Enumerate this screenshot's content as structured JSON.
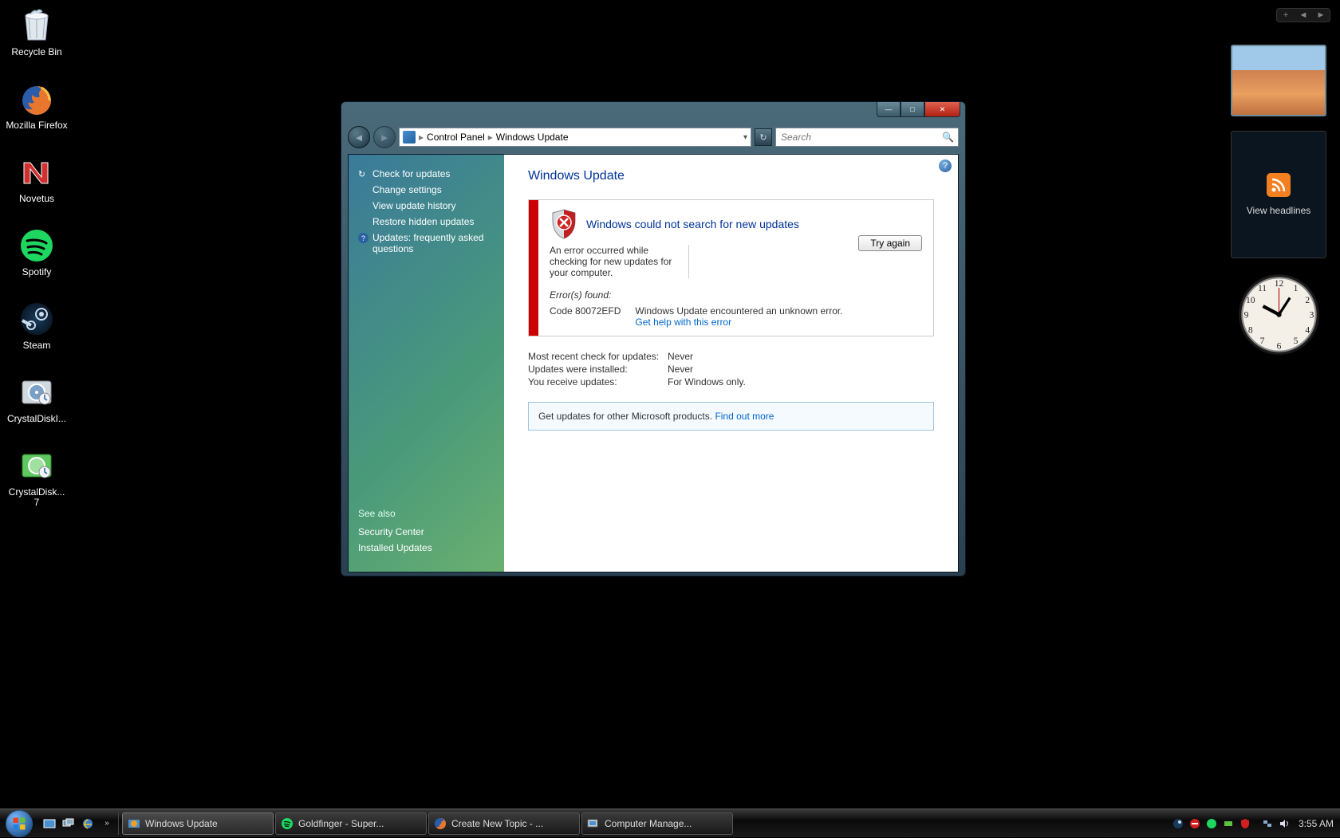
{
  "desktop": {
    "icons": [
      {
        "id": "recycle-bin",
        "label": "Recycle Bin"
      },
      {
        "id": "mozilla-firefox",
        "label": "Mozilla Firefox"
      },
      {
        "id": "novetus",
        "label": "Novetus"
      },
      {
        "id": "spotify",
        "label": "Spotify"
      },
      {
        "id": "steam",
        "label": "Steam"
      },
      {
        "id": "crystaldiskinfo",
        "label": "CrystalDiskI..."
      },
      {
        "id": "crystaldiskinfo7",
        "label": "CrystalDisk... 7"
      }
    ]
  },
  "window": {
    "breadcrumb": {
      "root": "Control Panel",
      "leaf": "Windows Update"
    },
    "search_placeholder": "Search",
    "sidebar": {
      "links": [
        {
          "id": "check-for-updates",
          "label": "Check for updates",
          "icon": "↻"
        },
        {
          "id": "change-settings",
          "label": "Change settings",
          "icon": ""
        },
        {
          "id": "view-update-history",
          "label": "View update history",
          "icon": ""
        },
        {
          "id": "restore-hidden-updates",
          "label": "Restore hidden updates",
          "icon": ""
        },
        {
          "id": "faq",
          "label": "Updates: frequently asked questions",
          "icon": "?"
        }
      ],
      "see_also_heading": "See also",
      "see_also": [
        {
          "id": "security-center",
          "label": "Security Center"
        },
        {
          "id": "installed-updates",
          "label": "Installed Updates"
        }
      ]
    },
    "main": {
      "title": "Windows Update",
      "error_heading": "Windows could not search for new updates",
      "error_body": "An error occurred while checking for new updates for your computer.",
      "try_again": "Try again",
      "errors_found": "Error(s) found:",
      "error_code_label": "Code 80072EFD",
      "error_code_desc": "Windows Update encountered an unknown error.",
      "get_help": "Get help with this error",
      "kv": [
        {
          "k": "Most recent check for updates:",
          "v": "Never"
        },
        {
          "k": "Updates were installed:",
          "v": "Never"
        },
        {
          "k": "You receive updates:",
          "v": "For Windows only."
        }
      ],
      "promo_text": "Get updates for other Microsoft products. ",
      "promo_link": "Find out more"
    }
  },
  "gadgets": {
    "feed_label": "View headlines"
  },
  "taskbar": {
    "tasks": [
      {
        "id": "windows-update",
        "label": "Windows Update",
        "active": true,
        "icon": "wu"
      },
      {
        "id": "spotify",
        "label": "Goldfinger - Super...",
        "active": false,
        "icon": "sp"
      },
      {
        "id": "firefox",
        "label": "Create New Topic - ...",
        "active": false,
        "icon": "ff"
      },
      {
        "id": "compmgmt",
        "label": "Computer Manage...",
        "active": false,
        "icon": "cm"
      }
    ],
    "clock": "3:55 AM"
  }
}
